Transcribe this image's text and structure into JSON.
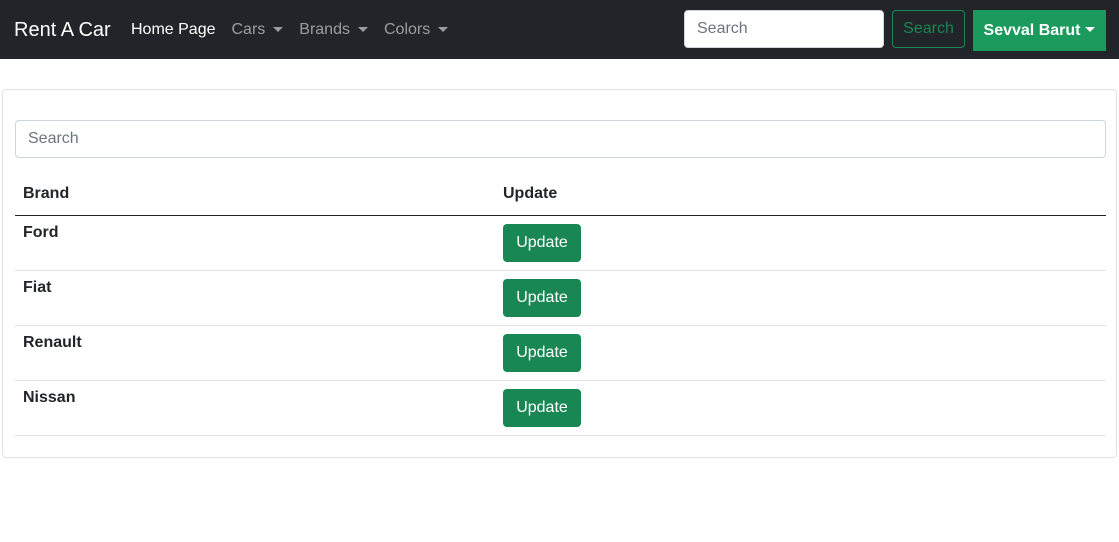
{
  "navbar": {
    "brand": "Rent A Car",
    "links": [
      {
        "label": "Home Page",
        "dropdown": false,
        "active": true
      },
      {
        "label": "Cars",
        "dropdown": true,
        "active": false
      },
      {
        "label": "Brands",
        "dropdown": true,
        "active": false
      },
      {
        "label": "Colors",
        "dropdown": true,
        "active": false
      }
    ],
    "search_placeholder": "Search",
    "search_button": "Search",
    "user_label": "Sevval Barut"
  },
  "content": {
    "search_placeholder": "Search",
    "table": {
      "headers": [
        "Brand",
        "Update"
      ],
      "rows": [
        {
          "brand": "Ford",
          "action": "Update"
        },
        {
          "brand": "Fiat",
          "action": "Update"
        },
        {
          "brand": "Renault",
          "action": "Update"
        },
        {
          "brand": "Nissan",
          "action": "Update"
        }
      ]
    }
  },
  "colors": {
    "navbar_bg": "#212529",
    "success": "#198754",
    "user_button": "#1a9a5c"
  }
}
